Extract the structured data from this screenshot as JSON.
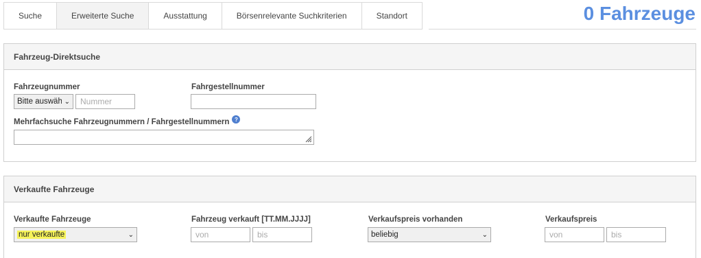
{
  "tabs": [
    {
      "label": "Suche",
      "active": false
    },
    {
      "label": "Erweiterte Suche",
      "active": true
    },
    {
      "label": "Ausstattung",
      "active": false
    },
    {
      "label": "Börsenrelevante Suchkriterien",
      "active": false
    },
    {
      "label": "Standort",
      "active": false
    }
  ],
  "result_count": "0 Fahrzeuge",
  "direct_search": {
    "title": "Fahrzeug-Direktsuche",
    "vehicle_number_label": "Fahrzeugnummer",
    "vehicle_number_select": "Bitte auswäh",
    "vehicle_number_placeholder": "Nummer",
    "chassis_number_label": "Fahrgestellnummer",
    "multi_search_label": "Mehrfachsuche Fahrzeugnummern / Fahrgestellnummern",
    "help_icon": "?"
  },
  "sold_vehicles": {
    "title": "Verkaufte Fahrzeuge",
    "sold_label": "Verkaufte Fahrzeuge",
    "sold_value": "nur verkaufte",
    "sold_date_label": "Fahrzeug verkauft [TT.MM.JJJJ]",
    "from_placeholder": "von",
    "to_placeholder": "bis",
    "price_available_label": "Verkaufspreis vorhanden",
    "price_available_value": "beliebig",
    "price_label": "Verkaufspreis",
    "price_from_placeholder": "von",
    "price_to_placeholder": "bis"
  },
  "colors": {
    "accent": "#5b8fe0",
    "highlight": "#f6f35a"
  }
}
